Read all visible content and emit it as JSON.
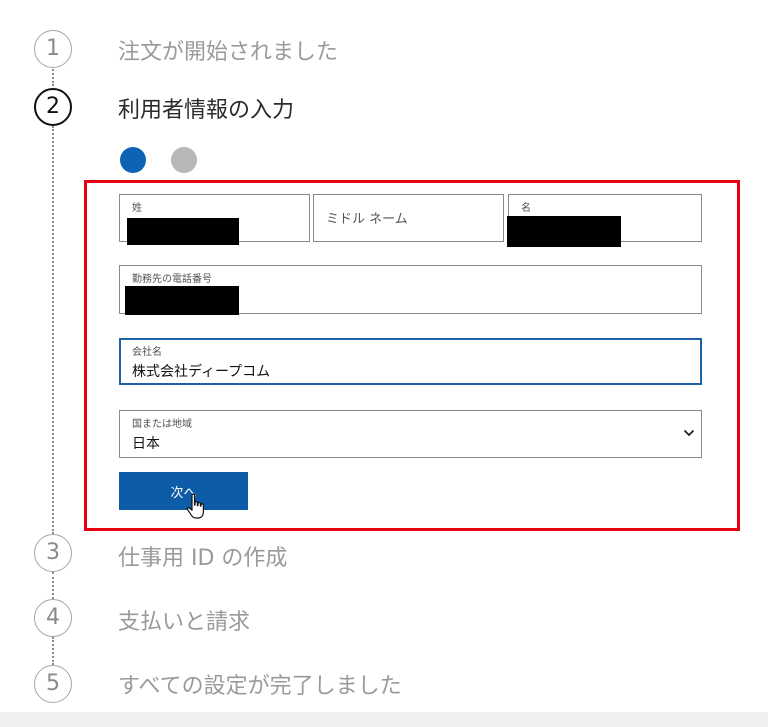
{
  "steps": [
    {
      "number": "1",
      "title": "注文が開始されました"
    },
    {
      "number": "2",
      "title": "利用者情報の入力"
    },
    {
      "number": "3",
      "title": "仕事用 ID の作成"
    },
    {
      "number": "4",
      "title": "支払いと請求"
    },
    {
      "number": "5",
      "title": "すべての設定が完了しました"
    }
  ],
  "active_step": 2,
  "substep_progress": {
    "current": 1,
    "total": 2
  },
  "form": {
    "last_name": {
      "label": "姓",
      "value_redacted": true
    },
    "middle_name": {
      "placeholder": "ミドル ネーム"
    },
    "first_name": {
      "label": "名",
      "value_redacted": true
    },
    "work_phone": {
      "label": "勤務先の電話番号",
      "value_redacted": true
    },
    "company": {
      "label": "会社名",
      "value": "株式会社ディープコム"
    },
    "region": {
      "label": "国または地域",
      "value": "日本"
    }
  },
  "next_button": {
    "label": "次へ"
  },
  "colors": {
    "accent": "#0e64b4",
    "highlight_frame": "#e60012",
    "inactive_dot": "#b8b8b8",
    "focused_border": "#1c62a6"
  },
  "icons": [
    "chevron-down-icon",
    "hand-pointer-cursor-icon"
  ]
}
